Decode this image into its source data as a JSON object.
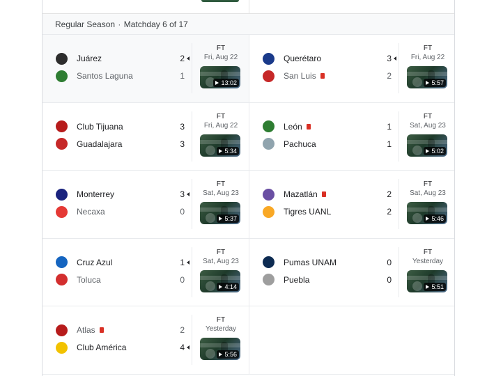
{
  "section": {
    "stage": "Regular Season",
    "separator": "·",
    "matchday": "Matchday 6 of 17"
  },
  "matches": [
    {
      "home": {
        "name": "Juárez",
        "score": "2",
        "winner": true,
        "crest_color": "#2d2d2d",
        "red_card": false
      },
      "away": {
        "name": "Santos Laguna",
        "score": "1",
        "winner": false,
        "crest_color": "#2e7d32",
        "red_card": false
      },
      "status": "FT",
      "date": "Fri, Aug 22",
      "duration": "13:02",
      "highlight": true
    },
    {
      "home": {
        "name": "Querétaro",
        "score": "3",
        "winner": true,
        "crest_color": "#1a3a8a",
        "red_card": false
      },
      "away": {
        "name": "San Luis",
        "score": "2",
        "winner": false,
        "crest_color": "#c62828",
        "red_card": true
      },
      "status": "FT",
      "date": "Fri, Aug 22",
      "duration": "5:57",
      "highlight": false
    },
    {
      "home": {
        "name": "Club Tijuana",
        "score": "3",
        "winner": false,
        "crest_color": "#b71c1c",
        "red_card": false
      },
      "away": {
        "name": "Guadalajara",
        "score": "3",
        "winner": false,
        "crest_color": "#c62828",
        "red_card": false
      },
      "status": "FT",
      "date": "Fri, Aug 22",
      "duration": "5:34",
      "highlight": false
    },
    {
      "home": {
        "name": "León",
        "score": "1",
        "winner": false,
        "crest_color": "#2e7d32",
        "red_card": true
      },
      "away": {
        "name": "Pachuca",
        "score": "1",
        "winner": false,
        "crest_color": "#90a4ae",
        "red_card": false
      },
      "status": "FT",
      "date": "Sat, Aug 23",
      "duration": "5:02",
      "highlight": false
    },
    {
      "home": {
        "name": "Monterrey",
        "score": "3",
        "winner": true,
        "crest_color": "#1a237e",
        "red_card": false
      },
      "away": {
        "name": "Necaxa",
        "score": "0",
        "winner": false,
        "crest_color": "#e53935",
        "red_card": false
      },
      "status": "FT",
      "date": "Sat, Aug 23",
      "duration": "5:37",
      "highlight": false
    },
    {
      "home": {
        "name": "Mazatlán",
        "score": "2",
        "winner": false,
        "crest_color": "#6a4fa3",
        "red_card": true
      },
      "away": {
        "name": "Tigres UANL",
        "score": "2",
        "winner": false,
        "crest_color": "#f9a825",
        "red_card": false
      },
      "status": "FT",
      "date": "Sat, Aug 23",
      "duration": "5:46",
      "highlight": false
    },
    {
      "home": {
        "name": "Cruz Azul",
        "score": "1",
        "winner": true,
        "crest_color": "#1565c0",
        "red_card": false
      },
      "away": {
        "name": "Toluca",
        "score": "0",
        "winner": false,
        "crest_color": "#d32f2f",
        "red_card": false
      },
      "status": "FT",
      "date": "Sat, Aug 23",
      "duration": "4:14",
      "highlight": false
    },
    {
      "home": {
        "name": "Pumas UNAM",
        "score": "0",
        "winner": false,
        "crest_color": "#0d2b52",
        "red_card": false
      },
      "away": {
        "name": "Puebla",
        "score": "0",
        "winner": false,
        "crest_color": "#9e9e9e",
        "red_card": false
      },
      "status": "FT",
      "date": "Yesterday",
      "duration": "5:51",
      "highlight": false
    },
    {
      "home": {
        "name": "Atlas",
        "score": "2",
        "winner": false,
        "crest_color": "#b71c1c",
        "red_card": true
      },
      "away": {
        "name": "Club América",
        "score": "4",
        "winner": true,
        "crest_color": "#f2c200",
        "red_card": false
      },
      "status": "FT",
      "date": "Yesterday",
      "duration": "5:56",
      "highlight": false
    }
  ]
}
